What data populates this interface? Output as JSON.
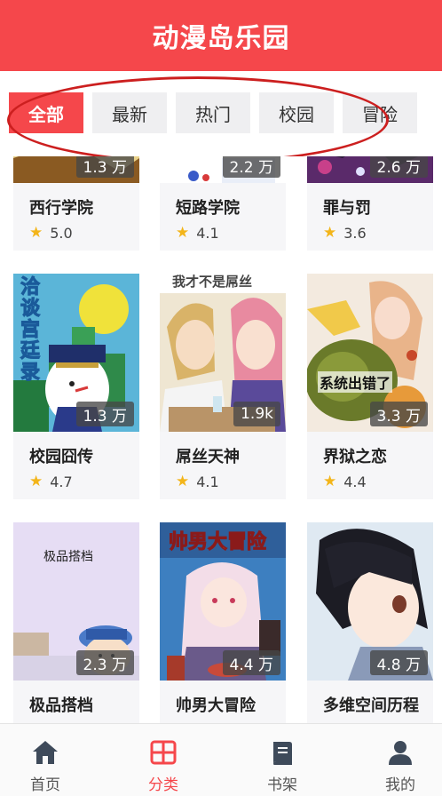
{
  "app_title": "动漫岛乐园",
  "tabs": [
    "全部",
    "最新",
    "热门",
    "校园",
    "冒险"
  ],
  "active_tab": "全部",
  "comics": [
    {
      "title": "西行学院",
      "count": "1.3 万",
      "rating": "5.0"
    },
    {
      "title": "短路学院",
      "count": "2.2 万",
      "rating": "4.1"
    },
    {
      "title": "罪与罚",
      "count": "2.6 万",
      "rating": "3.6"
    },
    {
      "title": "校园囧传",
      "count": "1.3 万",
      "rating": "4.7",
      "cover_text": "洽谈宫廷录"
    },
    {
      "title": "屌丝天神",
      "count": "1.9k",
      "rating": "4.1",
      "cover_text": "我才不是屌丝"
    },
    {
      "title": "界狱之恋",
      "count": "3.3 万",
      "rating": "4.4",
      "cover_text": "系统出错了"
    },
    {
      "title": "极品搭档",
      "count": "2.3 万",
      "rating": "",
      "cover_text": "极品搭档"
    },
    {
      "title": "帅男大冒险",
      "count": "4.4 万",
      "rating": "",
      "cover_text": "帅男大冒险"
    },
    {
      "title": "多维空间历程",
      "count": "4.8 万",
      "rating": ""
    }
  ],
  "nav": [
    {
      "label": "首页",
      "icon": "home-icon"
    },
    {
      "label": "分类",
      "icon": "category-icon"
    },
    {
      "label": "书架",
      "icon": "bookshelf-icon"
    },
    {
      "label": "我的",
      "icon": "profile-icon"
    }
  ],
  "active_nav": "分类",
  "colors": {
    "accent": "#f5474b",
    "star": "#f3b51a",
    "tab_bg": "#efeff1",
    "card_bg": "#f6f6f8"
  }
}
